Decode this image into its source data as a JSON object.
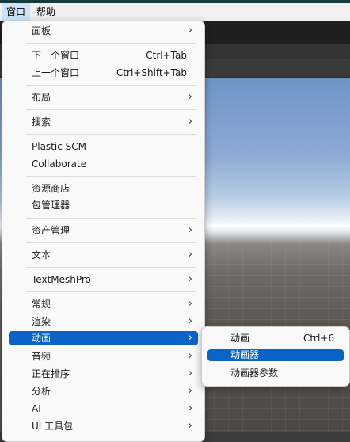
{
  "menubar": {
    "items": [
      {
        "label": "窗口",
        "active": true
      },
      {
        "label": "帮助",
        "active": false
      }
    ]
  },
  "menu": {
    "groups": [
      [
        {
          "label": "面板",
          "submenu": true
        }
      ],
      [
        {
          "label": "下一个窗口",
          "shortcut": "Ctrl+Tab"
        },
        {
          "label": "上一个窗口",
          "shortcut": "Ctrl+Shift+Tab"
        }
      ],
      [
        {
          "label": "布局",
          "submenu": true
        }
      ],
      [
        {
          "label": "搜索",
          "submenu": true
        }
      ],
      [
        {
          "label": "Plastic SCM"
        },
        {
          "label": "Collaborate"
        }
      ],
      [
        {
          "label": "资源商店"
        },
        {
          "label": "包管理器"
        }
      ],
      [
        {
          "label": "资产管理",
          "submenu": true
        }
      ],
      [
        {
          "label": "文本",
          "submenu": true
        }
      ],
      [
        {
          "label": "TextMeshPro",
          "submenu": true
        }
      ],
      [
        {
          "label": "常规",
          "submenu": true
        },
        {
          "label": "渲染",
          "submenu": true
        },
        {
          "label": "动画",
          "submenu": true,
          "highlighted": true
        },
        {
          "label": "音频",
          "submenu": true
        },
        {
          "label": "正在排序",
          "submenu": true
        },
        {
          "label": "分析",
          "submenu": true
        },
        {
          "label": "AI",
          "submenu": true
        },
        {
          "label": "UI 工具包",
          "submenu": true
        }
      ]
    ]
  },
  "submenu": {
    "items": [
      {
        "label": "动画",
        "shortcut": "Ctrl+6"
      },
      {
        "label": "动画器",
        "highlighted": true
      },
      {
        "label": "动画器参数"
      }
    ]
  },
  "icons": {
    "submenu_arrow": "chevron-right-icon"
  },
  "colors": {
    "highlight": "#0a64c8",
    "menu_bg": "#f9f9f9"
  }
}
